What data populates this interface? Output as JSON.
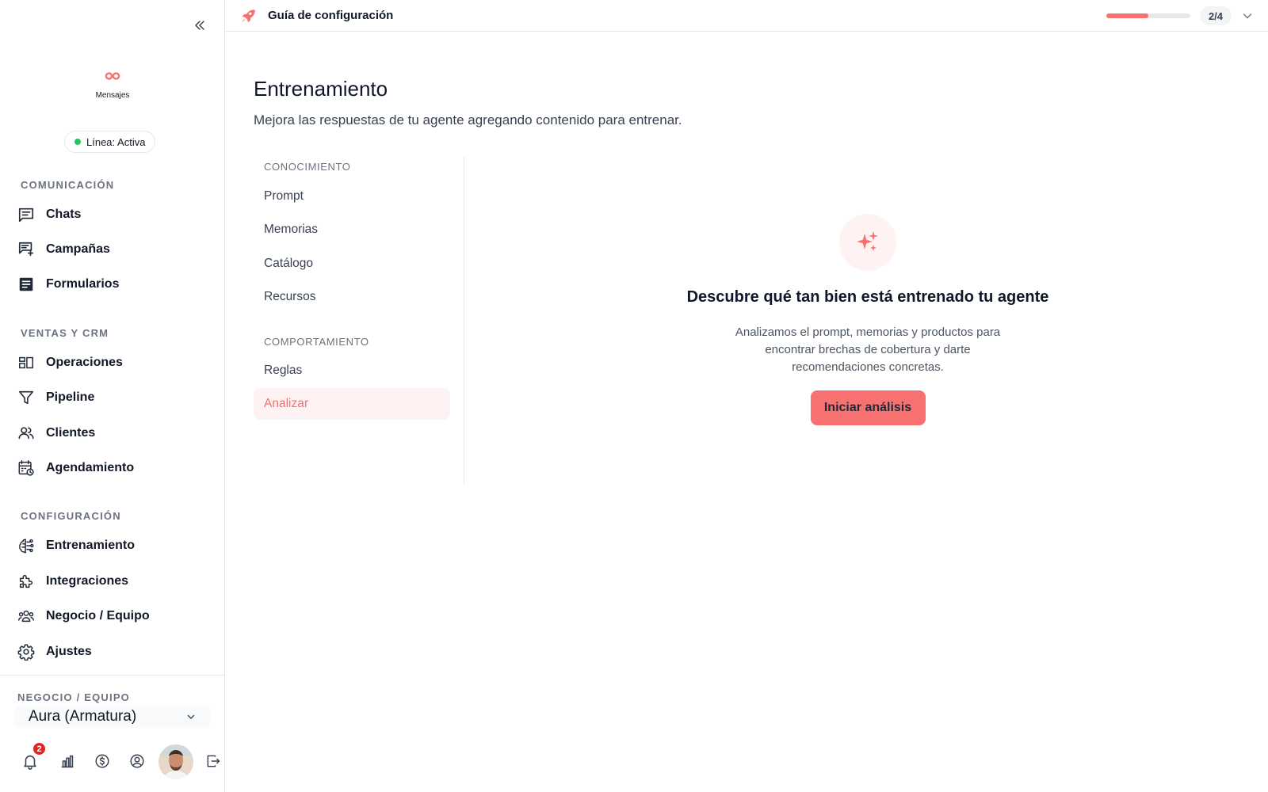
{
  "sidebar": {
    "logo_label": "Mensajes",
    "status_text": "Línea: Activa",
    "sections": [
      {
        "title": "COMUNICACIÓN",
        "items": [
          {
            "label": "Chats",
            "icon": "chat-icon"
          },
          {
            "label": "Campañas",
            "icon": "campaign-icon"
          },
          {
            "label": "Formularios",
            "icon": "form-icon"
          }
        ]
      },
      {
        "title": "VENTAS Y CRM",
        "items": [
          {
            "label": "Operaciones",
            "icon": "operations-icon"
          },
          {
            "label": "Pipeline",
            "icon": "filter-icon"
          },
          {
            "label": "Clientes",
            "icon": "users-icon"
          },
          {
            "label": "Agendamiento",
            "icon": "calendar-icon"
          }
        ]
      },
      {
        "title": "CONFIGURACIÓN",
        "items": [
          {
            "label": "Entrenamiento",
            "icon": "brain-icon"
          },
          {
            "label": "Integraciones",
            "icon": "puzzle-icon"
          },
          {
            "label": "Negocio / Equipo",
            "icon": "team-icon"
          },
          {
            "label": "Ajustes",
            "icon": "gear-icon"
          }
        ]
      }
    ],
    "business": {
      "title": "NEGOCIO / EQUIPO",
      "selected": "Aura (Armatura)"
    },
    "notifications_count": "2"
  },
  "topbar": {
    "title": "Guía de configuración",
    "progress": 0.5,
    "step": "2/4"
  },
  "main": {
    "title": "Entrenamiento",
    "subtitle": "Mejora las respuestas de tu agente agregando contenido para entrenar.",
    "subnav": {
      "groups": [
        {
          "heading": "CONOCIMIENTO",
          "items": [
            "Prompt",
            "Memorias",
            "Catálogo",
            "Recursos"
          ]
        },
        {
          "heading": "COMPORTAMIENTO",
          "items": [
            "Reglas",
            "Analizar"
          ]
        }
      ],
      "active": "Analizar"
    },
    "empty_state": {
      "title": "Descubre qué tan bien está entrenado tu agente",
      "description": "Analizamos el prompt, memorias y productos para encontrar brechas de cobertura y darte recomendaciones concretas.",
      "button": "Iniciar análisis"
    }
  },
  "colors": {
    "accent": "#f87171",
    "accent_soft": "#fef2f2",
    "status_green": "#22c55e",
    "badge_red": "#dc2626"
  }
}
